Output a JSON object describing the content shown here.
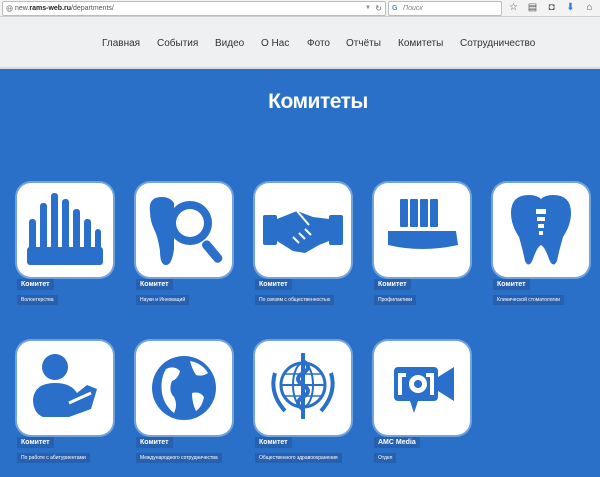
{
  "browser": {
    "url_prefix": "new.",
    "url_domain": "rams-web.ru",
    "url_path": "/departments/",
    "search_placeholder": "Поиск"
  },
  "nav": {
    "items": [
      "Главная",
      "События",
      "Видео",
      "О Нас",
      "Фото",
      "Отчёты",
      "Комитеты",
      "Сотрудничество"
    ]
  },
  "page": {
    "title": "Комитеты"
  },
  "cards": [
    {
      "title": "Комитет",
      "subtitle": "Волонтерства",
      "icon": "volunteer-hands-icon"
    },
    {
      "title": "Комитет",
      "subtitle": "Науки и Инноваций",
      "icon": "tooth-magnifier-icon"
    },
    {
      "title": "Комитет",
      "subtitle": "По связям с общественностью",
      "icon": "handshake-icon"
    },
    {
      "title": "Комитет",
      "subtitle": "Профилактики",
      "icon": "toothbrush-icon"
    },
    {
      "title": "Комитет",
      "subtitle": "Клинической стоматологии",
      "icon": "tooth-implant-icon"
    },
    {
      "title": "Комитет",
      "subtitle": "По работе с абитуриентами",
      "icon": "student-reading-icon"
    },
    {
      "title": "Комитет",
      "subtitle": "Международного сотрудничества",
      "icon": "globe-icon"
    },
    {
      "title": "Комитет",
      "subtitle": "Общественного здравоохранения",
      "icon": "who-emblem-icon"
    },
    {
      "title": "AMC Media",
      "subtitle": "Отдел",
      "icon": "video-camera-icon"
    }
  ],
  "colors": {
    "background": "#2a70c8",
    "tile": "#ffffff",
    "icon": "#2a6fc9",
    "header": "#eff0f2"
  }
}
